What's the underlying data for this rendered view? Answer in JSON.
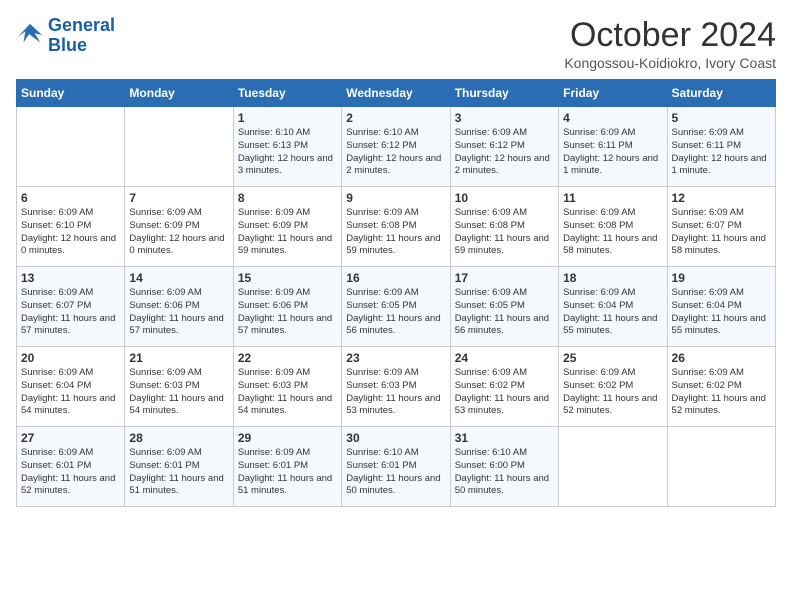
{
  "header": {
    "logo_line1": "General",
    "logo_line2": "Blue",
    "month": "October 2024",
    "location": "Kongossou-Koidiokro, Ivory Coast"
  },
  "weekdays": [
    "Sunday",
    "Monday",
    "Tuesday",
    "Wednesday",
    "Thursday",
    "Friday",
    "Saturday"
  ],
  "weeks": [
    [
      {
        "day": "",
        "info": ""
      },
      {
        "day": "",
        "info": ""
      },
      {
        "day": "1",
        "info": "Sunrise: 6:10 AM\nSunset: 6:13 PM\nDaylight: 12 hours and 3 minutes."
      },
      {
        "day": "2",
        "info": "Sunrise: 6:10 AM\nSunset: 6:12 PM\nDaylight: 12 hours and 2 minutes."
      },
      {
        "day": "3",
        "info": "Sunrise: 6:09 AM\nSunset: 6:12 PM\nDaylight: 12 hours and 2 minutes."
      },
      {
        "day": "4",
        "info": "Sunrise: 6:09 AM\nSunset: 6:11 PM\nDaylight: 12 hours and 1 minute."
      },
      {
        "day": "5",
        "info": "Sunrise: 6:09 AM\nSunset: 6:11 PM\nDaylight: 12 hours and 1 minute."
      }
    ],
    [
      {
        "day": "6",
        "info": "Sunrise: 6:09 AM\nSunset: 6:10 PM\nDaylight: 12 hours and 0 minutes."
      },
      {
        "day": "7",
        "info": "Sunrise: 6:09 AM\nSunset: 6:09 PM\nDaylight: 12 hours and 0 minutes."
      },
      {
        "day": "8",
        "info": "Sunrise: 6:09 AM\nSunset: 6:09 PM\nDaylight: 11 hours and 59 minutes."
      },
      {
        "day": "9",
        "info": "Sunrise: 6:09 AM\nSunset: 6:08 PM\nDaylight: 11 hours and 59 minutes."
      },
      {
        "day": "10",
        "info": "Sunrise: 6:09 AM\nSunset: 6:08 PM\nDaylight: 11 hours and 59 minutes."
      },
      {
        "day": "11",
        "info": "Sunrise: 6:09 AM\nSunset: 6:08 PM\nDaylight: 11 hours and 58 minutes."
      },
      {
        "day": "12",
        "info": "Sunrise: 6:09 AM\nSunset: 6:07 PM\nDaylight: 11 hours and 58 minutes."
      }
    ],
    [
      {
        "day": "13",
        "info": "Sunrise: 6:09 AM\nSunset: 6:07 PM\nDaylight: 11 hours and 57 minutes."
      },
      {
        "day": "14",
        "info": "Sunrise: 6:09 AM\nSunset: 6:06 PM\nDaylight: 11 hours and 57 minutes."
      },
      {
        "day": "15",
        "info": "Sunrise: 6:09 AM\nSunset: 6:06 PM\nDaylight: 11 hours and 57 minutes."
      },
      {
        "day": "16",
        "info": "Sunrise: 6:09 AM\nSunset: 6:05 PM\nDaylight: 11 hours and 56 minutes."
      },
      {
        "day": "17",
        "info": "Sunrise: 6:09 AM\nSunset: 6:05 PM\nDaylight: 11 hours and 56 minutes."
      },
      {
        "day": "18",
        "info": "Sunrise: 6:09 AM\nSunset: 6:04 PM\nDaylight: 11 hours and 55 minutes."
      },
      {
        "day": "19",
        "info": "Sunrise: 6:09 AM\nSunset: 6:04 PM\nDaylight: 11 hours and 55 minutes."
      }
    ],
    [
      {
        "day": "20",
        "info": "Sunrise: 6:09 AM\nSunset: 6:04 PM\nDaylight: 11 hours and 54 minutes."
      },
      {
        "day": "21",
        "info": "Sunrise: 6:09 AM\nSunset: 6:03 PM\nDaylight: 11 hours and 54 minutes."
      },
      {
        "day": "22",
        "info": "Sunrise: 6:09 AM\nSunset: 6:03 PM\nDaylight: 11 hours and 54 minutes."
      },
      {
        "day": "23",
        "info": "Sunrise: 6:09 AM\nSunset: 6:03 PM\nDaylight: 11 hours and 53 minutes."
      },
      {
        "day": "24",
        "info": "Sunrise: 6:09 AM\nSunset: 6:02 PM\nDaylight: 11 hours and 53 minutes."
      },
      {
        "day": "25",
        "info": "Sunrise: 6:09 AM\nSunset: 6:02 PM\nDaylight: 11 hours and 52 minutes."
      },
      {
        "day": "26",
        "info": "Sunrise: 6:09 AM\nSunset: 6:02 PM\nDaylight: 11 hours and 52 minutes."
      }
    ],
    [
      {
        "day": "27",
        "info": "Sunrise: 6:09 AM\nSunset: 6:01 PM\nDaylight: 11 hours and 52 minutes."
      },
      {
        "day": "28",
        "info": "Sunrise: 6:09 AM\nSunset: 6:01 PM\nDaylight: 11 hours and 51 minutes."
      },
      {
        "day": "29",
        "info": "Sunrise: 6:09 AM\nSunset: 6:01 PM\nDaylight: 11 hours and 51 minutes."
      },
      {
        "day": "30",
        "info": "Sunrise: 6:10 AM\nSunset: 6:01 PM\nDaylight: 11 hours and 50 minutes."
      },
      {
        "day": "31",
        "info": "Sunrise: 6:10 AM\nSunset: 6:00 PM\nDaylight: 11 hours and 50 minutes."
      },
      {
        "day": "",
        "info": ""
      },
      {
        "day": "",
        "info": ""
      }
    ]
  ]
}
